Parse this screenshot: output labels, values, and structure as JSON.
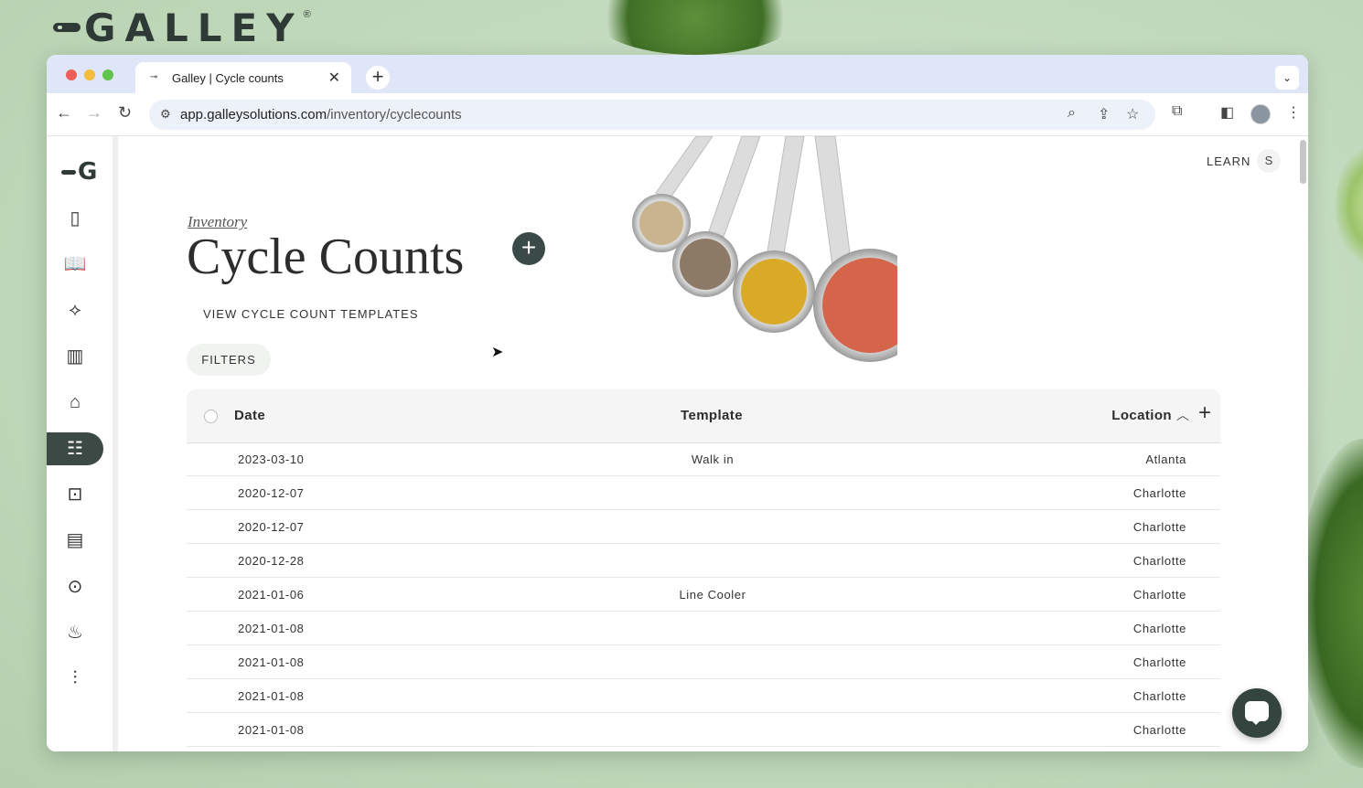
{
  "brand": {
    "name": "GALLEY",
    "reg": "®"
  },
  "browser": {
    "tab_title": "Galley | Cycle counts",
    "tab_close": "✕",
    "new_tab": "+",
    "url_host": "app.galleysolutions.com",
    "url_path": "/inventory/cyclecounts"
  },
  "header": {
    "learn_label": "LEARN",
    "user_initial": "S"
  },
  "sidebar": {
    "logo_letter": "G",
    "items": [
      {
        "icon": "clipboard-icon"
      },
      {
        "icon": "book-icon"
      },
      {
        "icon": "vegetable-icon"
      },
      {
        "icon": "containers-icon"
      },
      {
        "icon": "tag-icon"
      },
      {
        "icon": "checklist-icon",
        "active": true
      },
      {
        "icon": "cart-icon"
      },
      {
        "icon": "document-icon"
      },
      {
        "icon": "location-icon"
      },
      {
        "icon": "dining-icon"
      },
      {
        "icon": "sliders-icon"
      }
    ]
  },
  "main": {
    "breadcrumb": "Inventory",
    "title": "Cycle Counts",
    "add_label": "+",
    "templates_link": "VIEW CYCLE COUNT TEMPLATES",
    "filters_label": "FILTERS"
  },
  "table": {
    "columns": {
      "date": "Date",
      "template": "Template",
      "location": "Location"
    },
    "rows": [
      {
        "date": "2023-03-10",
        "template": "Walk in",
        "location": "Atlanta"
      },
      {
        "date": "2020-12-07",
        "template": "",
        "location": "Charlotte"
      },
      {
        "date": "2020-12-07",
        "template": "",
        "location": "Charlotte"
      },
      {
        "date": "2020-12-28",
        "template": "",
        "location": "Charlotte"
      },
      {
        "date": "2021-01-06",
        "template": "Line Cooler",
        "location": "Charlotte"
      },
      {
        "date": "2021-01-08",
        "template": "",
        "location": "Charlotte"
      },
      {
        "date": "2021-01-08",
        "template": "",
        "location": "Charlotte"
      },
      {
        "date": "2021-01-08",
        "template": "",
        "location": "Charlotte"
      },
      {
        "date": "2021-01-08",
        "template": "",
        "location": "Charlotte"
      }
    ]
  },
  "colors": {
    "accent": "#3a4a46",
    "background": "#bfd8ba"
  }
}
